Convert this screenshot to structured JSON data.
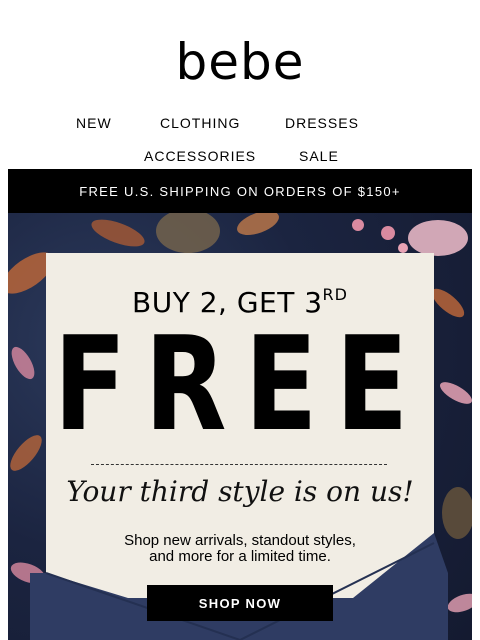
{
  "brand": {
    "logo_text": "bebe"
  },
  "nav": {
    "items": [
      "NEW",
      "CLOTHING",
      "DRESSES",
      "ACCESSORIES",
      "SALE"
    ]
  },
  "shipping_banner": {
    "text": "FREE U.S. SHIPPING ON ORDERS OF $150+"
  },
  "promo": {
    "headline_prefix": "BUY 2, GET 3",
    "headline_superscript": "RD",
    "headline_main": "FREE",
    "tagline": "Your third style is on us!",
    "body_line1": "Shop new arrivals, standout styles,",
    "body_line2": "and more for a limited time.",
    "cta_label": "SHOP NOW"
  },
  "colors": {
    "hero_background": "#1b2440",
    "card_background": "#f1ede4",
    "envelope": "#2f3c63",
    "floral_pink": "#d98aa0",
    "floral_orange": "#b8653a"
  }
}
